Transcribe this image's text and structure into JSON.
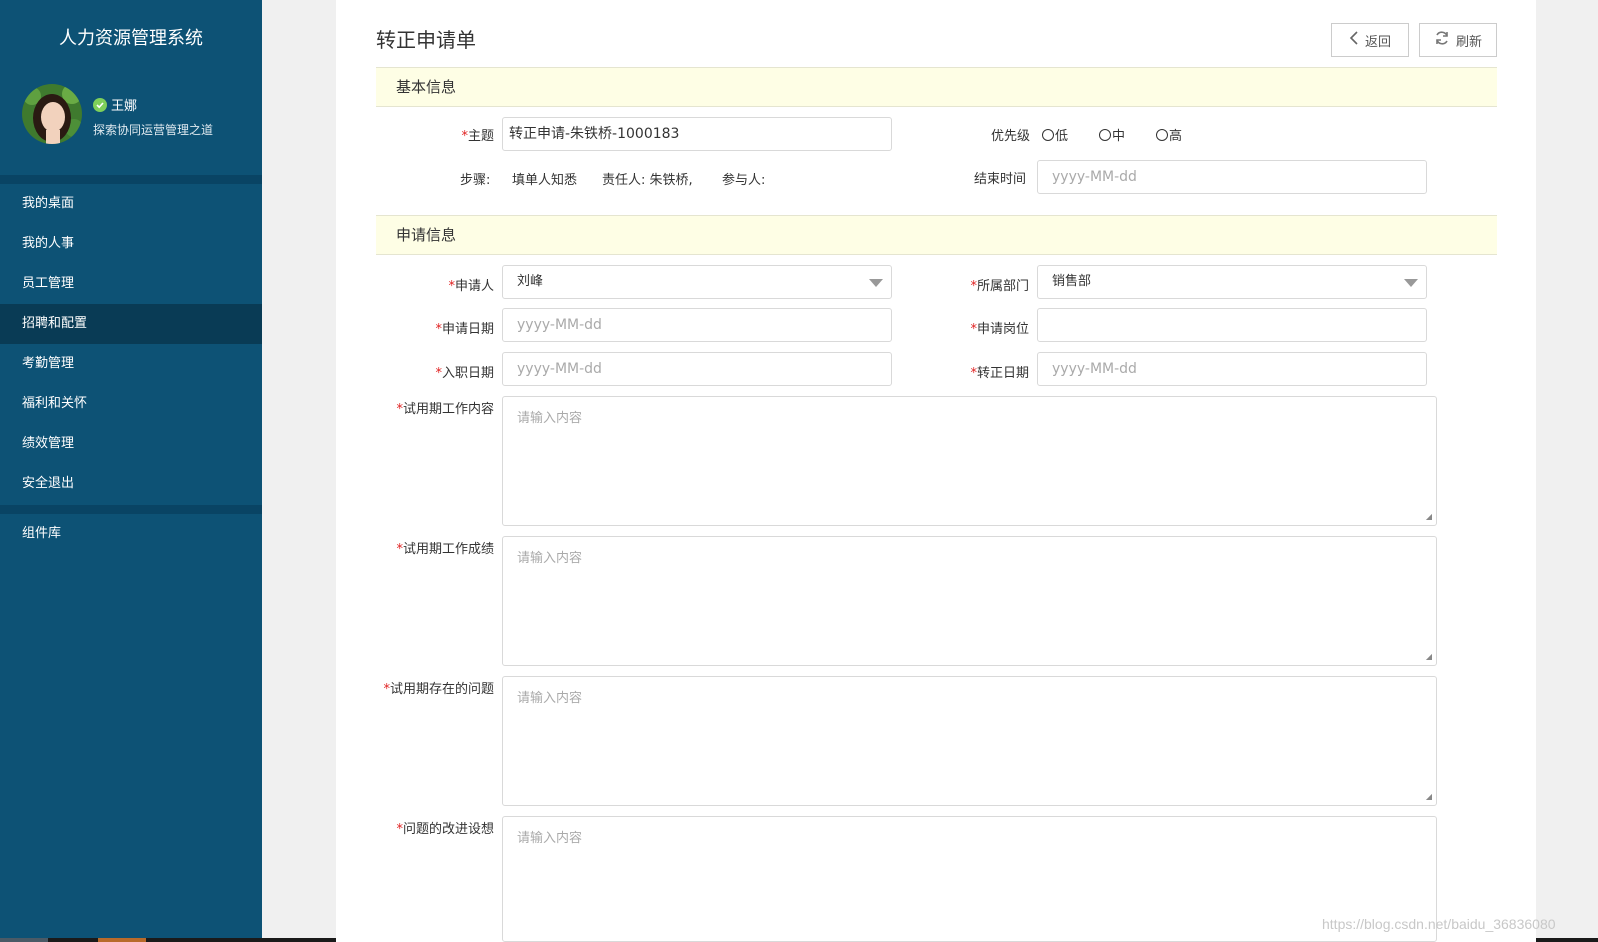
{
  "sidebar": {
    "app_title": "人力资源管理系统",
    "user": {
      "name": "王娜",
      "motto": "探索协同运营管理之道",
      "status_color": "#7ed05a"
    },
    "menu": [
      {
        "label": "我的桌面"
      },
      {
        "label": "我的人事"
      },
      {
        "label": "员工管理"
      },
      {
        "label": "招聘和配置",
        "active": true
      },
      {
        "label": "考勤管理"
      },
      {
        "label": "福利和关怀"
      },
      {
        "label": "绩效管理"
      },
      {
        "label": "安全退出"
      }
    ],
    "extra_menu": [
      {
        "label": "组件库"
      }
    ]
  },
  "header": {
    "title": "转正申请单",
    "back_label": "返回",
    "refresh_label": "刷新"
  },
  "basic": {
    "section_title": "基本信息",
    "subject_label": "主题",
    "subject_value": "转正申请-朱铁桥-1000183",
    "priority_label": "优先级",
    "priority_options": [
      "低",
      "中",
      "高"
    ],
    "steps_label": "步骤:",
    "steps_text": "填单人知悉",
    "owner_text": "责任人: 朱铁桥,",
    "participant_text": "参与人:",
    "end_time_label": "结束时间",
    "end_time_placeholder": "yyyy-MM-dd"
  },
  "apply": {
    "section_title": "申请信息",
    "applicant_label": "申请人",
    "applicant_value": "刘峰",
    "dept_label": "所属部门",
    "dept_value": "销售部",
    "apply_date_label": "申请日期",
    "apply_date_placeholder": "yyyy-MM-dd",
    "position_label": "申请岗位",
    "position_value": "",
    "entry_date_label": "入职日期",
    "entry_date_placeholder": "yyyy-MM-dd",
    "regular_date_label": "转正日期",
    "regular_date_placeholder": "yyyy-MM-dd",
    "work_content_label": "试用期工作内容",
    "work_result_label": "试用期工作成绩",
    "problems_label": "试用期存在的问题",
    "improve_label": "问题的改进设想",
    "textarea_placeholder": "请输入内容"
  },
  "required_mark": "*",
  "watermark": "https://blog.csdn.net/baidu_36836080",
  "colors": {
    "sidebar_bg": "#0d5275",
    "sidebar_active": "#093b55",
    "section_bg": "#fefee5",
    "required": "#e02020"
  }
}
